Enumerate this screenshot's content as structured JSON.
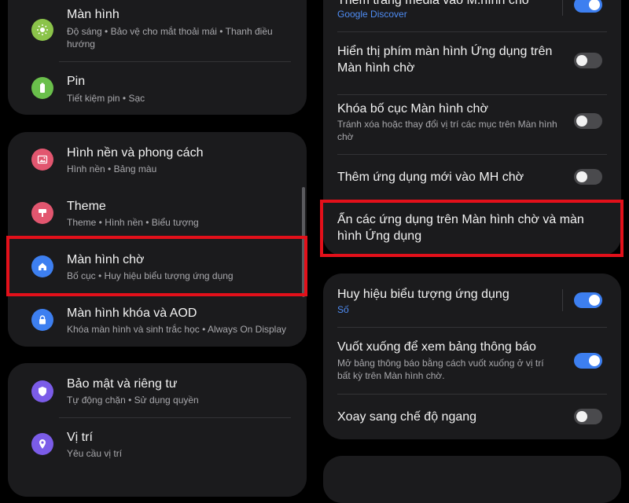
{
  "left": {
    "display": {
      "title": "Màn hình",
      "subtitle": "Độ sáng  •  Bảo vệ cho mắt thoải mái  •  Thanh điều hướng",
      "icon": "sun-icon",
      "icon_color": "#8bc34a"
    },
    "battery": {
      "title": "Pin",
      "subtitle": "Tiết kiệm pin  •  Sạc",
      "icon": "battery-icon",
      "icon_color": "#6abf4b"
    },
    "wallpaper": {
      "title": "Hình nền và phong cách",
      "subtitle": "Hình nền  •  Bảng màu",
      "icon": "image-icon",
      "icon_color": "#e2566f"
    },
    "theme": {
      "title": "Theme",
      "subtitle": "Theme  •  Hình nền  •  Biểu tượng",
      "icon": "brush-icon",
      "icon_color": "#e2566f"
    },
    "home_screen": {
      "title": "Màn hình chờ",
      "subtitle": "Bố cục  •  Huy hiệu biểu tượng ứng dụng",
      "icon": "home-icon",
      "icon_color": "#3d7ff0"
    },
    "lock_screen": {
      "title": "Màn hình khóa và AOD",
      "subtitle": "Khóa màn hình và sinh trắc học  •  Always On Display",
      "icon": "lock-icon",
      "icon_color": "#3d7ff0"
    },
    "security": {
      "title": "Bảo mật và riêng tư",
      "subtitle": "Tự động chặn  •  Sử dụng quyền",
      "icon": "shield-icon",
      "icon_color": "#7b5ce8"
    },
    "location": {
      "title": "Vị trí",
      "subtitle": "Yêu cầu vị trí",
      "icon": "location-pin-icon",
      "icon_color": "#7b5ce8"
    }
  },
  "right": {
    "media_page": {
      "title": "Thêm trang media vào M.hình chờ",
      "subtitle": "Google Discover",
      "toggle": "on"
    },
    "show_apps_button": {
      "title": "Hiển thị phím màn hình Ứng dụng trên Màn hình chờ",
      "toggle": "off"
    },
    "lock_layout": {
      "title": "Khóa bố cục Màn hình chờ",
      "subtitle": "Tránh xóa hoặc thay đổi vị trí các mục trên Màn hình chờ",
      "toggle": "off"
    },
    "add_new_apps": {
      "title": "Thêm ứng dụng mới vào MH chờ",
      "toggle": "off"
    },
    "hide_apps": {
      "title": "Ẩn các ứng dụng trên Màn hình chờ và màn hình Ứng dụng"
    },
    "app_badges": {
      "title": "Huy hiệu biểu tượng ứng dụng",
      "subtitle": "Số",
      "toggle": "on"
    },
    "swipe_down": {
      "title": "Vuốt xuống để xem bảng thông báo",
      "subtitle": "Mở bảng thông báo bằng cách vuốt xuống ở vị trí bất kỳ trên Màn hình chờ.",
      "toggle": "on"
    },
    "rotate": {
      "title": "Xoay sang chế độ ngang",
      "toggle": "off"
    }
  },
  "colors": {
    "highlight": "#e3101a",
    "toggle_on": "#3d7ff0",
    "card_bg": "#1b1b1d"
  }
}
